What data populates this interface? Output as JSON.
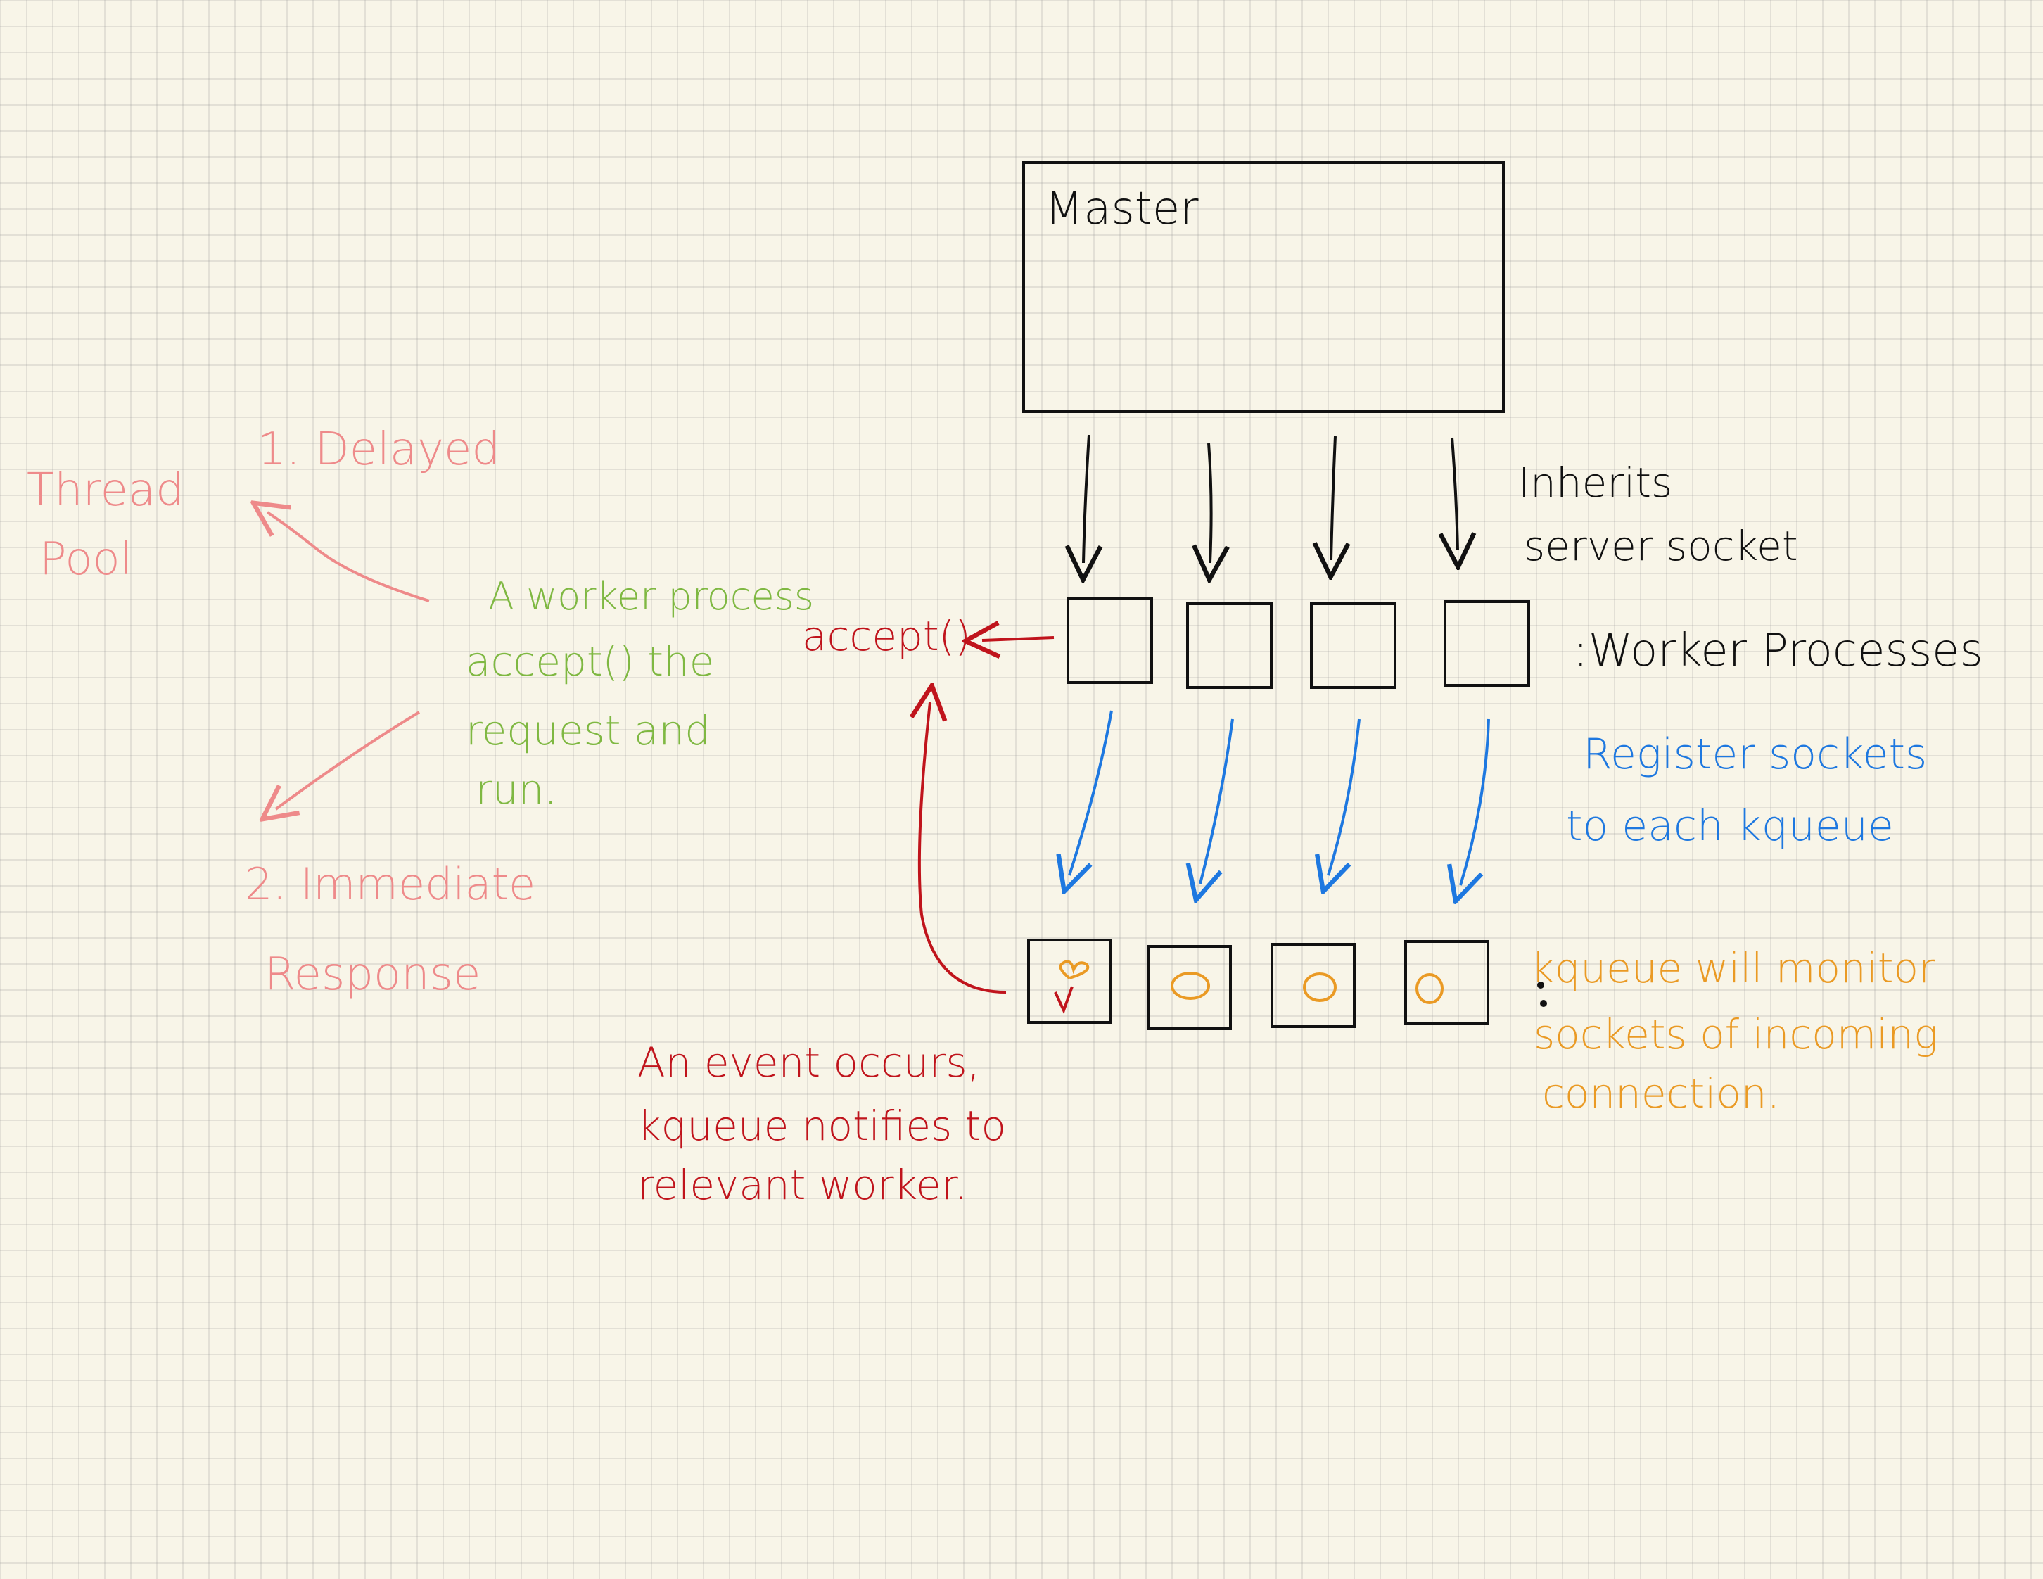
{
  "master": {
    "label": "Master"
  },
  "inherits": {
    "line1": "Inherits",
    "line2": "server socket"
  },
  "workers": {
    "label": ":Worker Processes"
  },
  "register": {
    "line1": "Register sockets",
    "line2": "to each kqueue"
  },
  "kqueue_note": {
    "line1": "kqueue will monitor",
    "line2": "sockets of incoming",
    "line3": "connection."
  },
  "event_note": {
    "line1": "An event occurs,",
    "line2": "kqueue notifies to",
    "line3": "relevant worker."
  },
  "accept": {
    "label": "accept()"
  },
  "green_note": {
    "line1": "A worker process",
    "line2": "accept() the",
    "line3": "request and",
    "line4": "run."
  },
  "thread_pool": {
    "line1": "Thread",
    "line2": "Pool"
  },
  "delayed": {
    "label": "1. Delayed"
  },
  "immediate": {
    "line1": "2. Immediate",
    "line2": "Response"
  },
  "colors": {
    "black": "#111111",
    "red": "#c0141c",
    "blue": "#1e78e0",
    "orange": "#ea9a24",
    "green": "#7fb842",
    "pink": "#ee8a8a"
  }
}
